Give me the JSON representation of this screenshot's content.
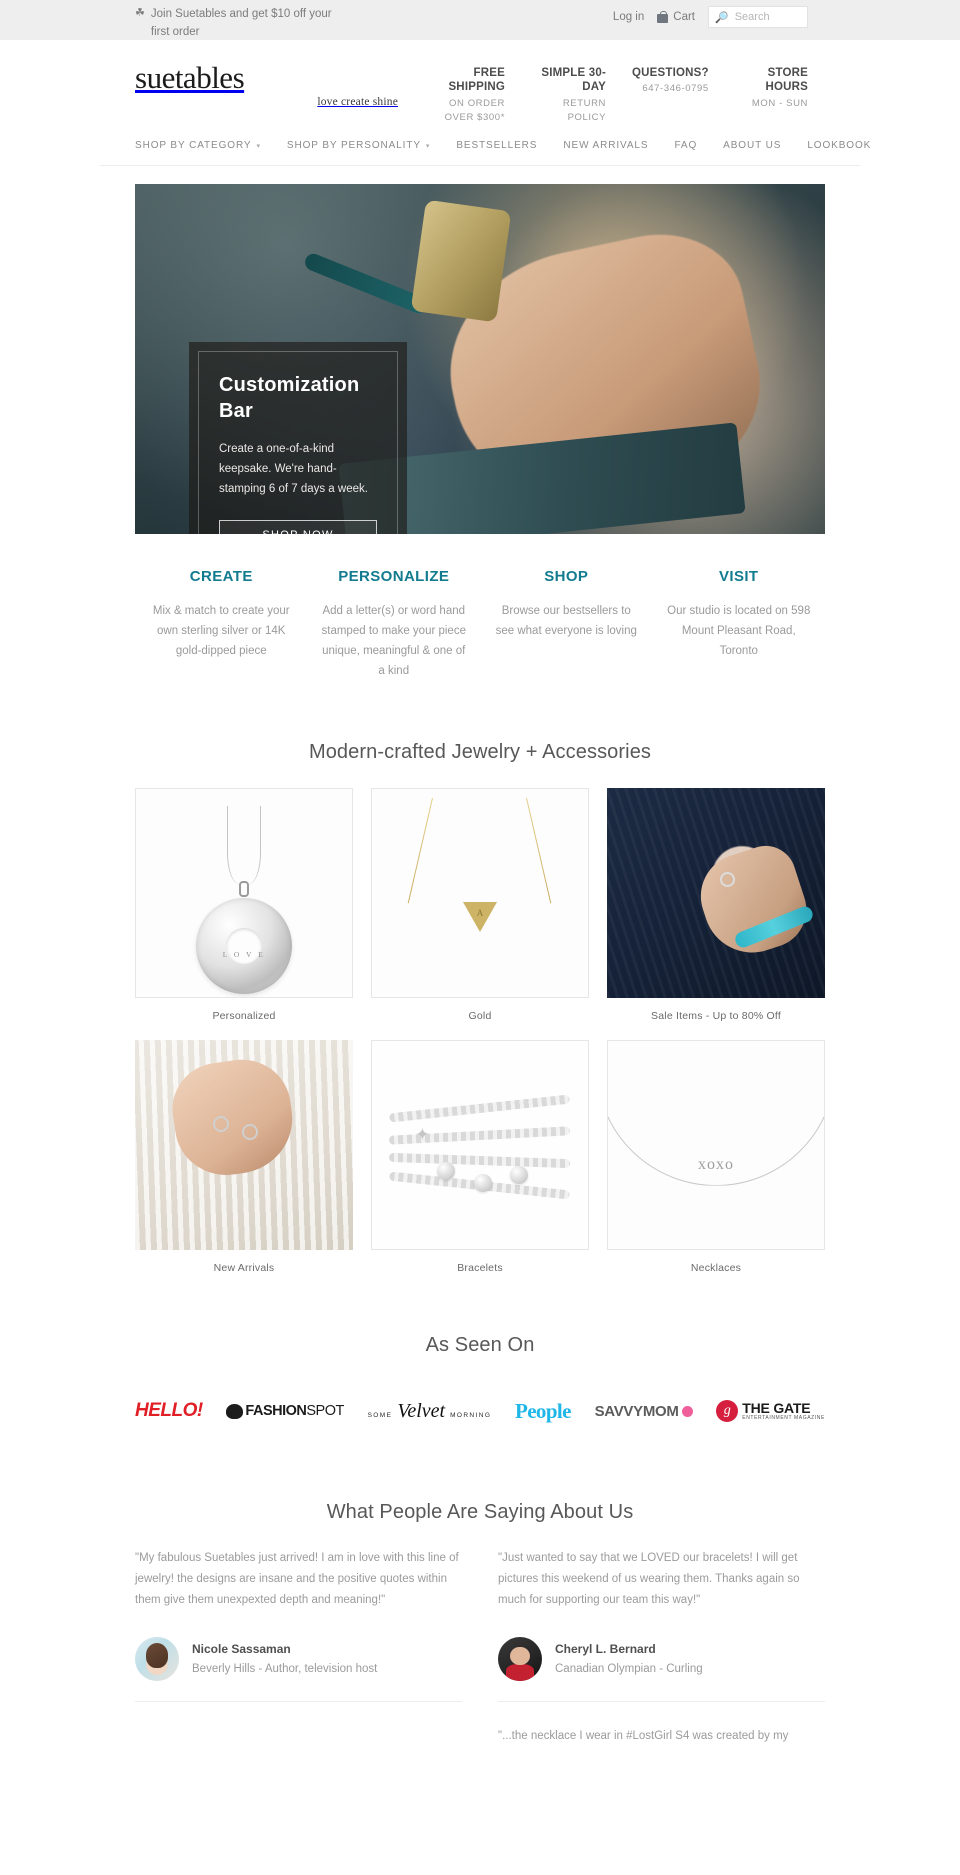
{
  "announce": {
    "gift_icon": "gift-icon",
    "promo_text": "Join Suetables and get $10 off your first order",
    "login_label": "Log in",
    "cart_label": "Cart",
    "search_placeholder": "Search",
    "search_value": ""
  },
  "brand": {
    "name": "suetables",
    "tagline": "love create shine"
  },
  "header_info": [
    {
      "title": "FREE SHIPPING",
      "sub": "ON ORDER OVER $300*"
    },
    {
      "title": "SIMPLE 30-DAY",
      "sub": "RETURN POLICY"
    },
    {
      "title": "QUESTIONS?",
      "sub": "647-346-0795"
    },
    {
      "title": "STORE HOURS",
      "sub": "MON - SUN"
    }
  ],
  "nav": [
    {
      "label": "SHOP BY CATEGORY",
      "has_caret": true
    },
    {
      "label": "SHOP BY PERSONALITY",
      "has_caret": true
    },
    {
      "label": "BESTSELLERS",
      "has_caret": false
    },
    {
      "label": "NEW ARRIVALS",
      "has_caret": false
    },
    {
      "label": "FAQ",
      "has_caret": false
    },
    {
      "label": "ABOUT US",
      "has_caret": false
    },
    {
      "label": "LOOKBOOK",
      "has_caret": false
    }
  ],
  "hero": {
    "title": "Customization Bar",
    "body": "Create a one-of-a-kind keepsake. We're hand-stamping 6 of 7 days a week.",
    "button_label": "SHOP NOW"
  },
  "props": [
    {
      "title": "CREATE",
      "text": "Mix & match to create your own sterling silver or 14K gold-dipped piece"
    },
    {
      "title": "PERSONALIZE",
      "text": "Add a letter(s) or word hand stamped to make your piece unique, meaningful & one of a kind"
    },
    {
      "title": "SHOP",
      "text": "Browse our bestsellers to see what everyone is loving"
    },
    {
      "title": "VISIT",
      "text": "Our studio is located on 598 Mount Pleasant Road, Toronto"
    }
  ],
  "grid": {
    "heading": "Modern-crafted Jewelry + Accessories",
    "tiles": [
      {
        "caption": "Personalized",
        "art": "washer",
        "stamp": "L O V E"
      },
      {
        "caption": "Gold",
        "art": "gold",
        "letter": "A"
      },
      {
        "caption": "Sale Items - Up to 80% Off",
        "art": "sale"
      },
      {
        "caption": "New Arrivals",
        "art": "new-arrivals"
      },
      {
        "caption": "Bracelets",
        "art": "bracelets"
      },
      {
        "caption": "Necklaces",
        "art": "necklaces",
        "word": "xoxo"
      }
    ]
  },
  "as_seen_on": {
    "heading": "As Seen On",
    "logos": [
      {
        "name": "HELLO!"
      },
      {
        "name": "the FASHIONSPOT",
        "pre": "the",
        "bold": "FASHION",
        "thin": "SPOT"
      },
      {
        "name": "SOME Velvet MORNING",
        "small1": "SOME",
        "script": "Velvet",
        "small2": "MORNING"
      },
      {
        "name": "People"
      },
      {
        "name": "SAVVYMOM"
      },
      {
        "name": "THE GATE ENTERTAINMENT MAGAZINE",
        "mark": "g",
        "line1": "THE GATE",
        "line2": "ENTERTAINMENT MAGAZINE"
      }
    ]
  },
  "testimonials": {
    "heading": "What People Are Saying About Us",
    "left": [
      {
        "quote": "\"My fabulous Suetables just arrived! I am in love with this line of jewelry! the designs are insane and the positive quotes within them give them unexpexted depth and meaning!\"",
        "name": "Nicole Sassaman",
        "role": "Beverly Hills - Author, television host"
      }
    ],
    "right": [
      {
        "quote": "\"Just wanted to say that we LOVED our bracelets! I will get pictures this weekend of us wearing them. Thanks again so much for supporting our team this way!\"",
        "name": "Cheryl L. Bernard",
        "role": "Canadian Olympian - Curling"
      },
      {
        "quote": "\"...the necklace I wear in #LostGirl S4 was created by my",
        "name": "",
        "role": ""
      }
    ]
  },
  "colors": {
    "accent": "#137b8f",
    "announce_bg": "#eeeeee",
    "body_text": "#9a9a9a",
    "heading_text": "#585858"
  }
}
